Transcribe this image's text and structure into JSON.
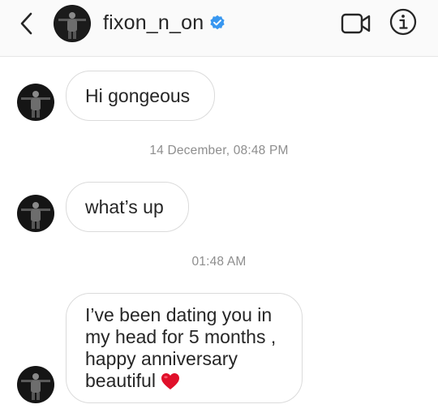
{
  "header": {
    "username": "fixon_n_on",
    "verified": true,
    "icons": {
      "back": "chevron-left-icon",
      "verified": "verified-badge-icon",
      "video": "video-camera-icon",
      "info": "info-icon"
    }
  },
  "thread": {
    "messages": [
      {
        "text": "Hi gongeous"
      },
      {
        "text": "what’s up"
      },
      {
        "text": "I’ve been dating you in\nmy head for 5 months ,\nhappy anniversary\nbeautiful",
        "emoji": "heart-emoji"
      }
    ],
    "timestamps": [
      "14 December, 08:48 PM",
      "01:48 AM"
    ]
  },
  "colors": {
    "verified_badge": "#3897f0",
    "bubble_border": "#dbdbdb",
    "timestamp_text": "#8e8e8e",
    "heart": "#e0102a"
  }
}
